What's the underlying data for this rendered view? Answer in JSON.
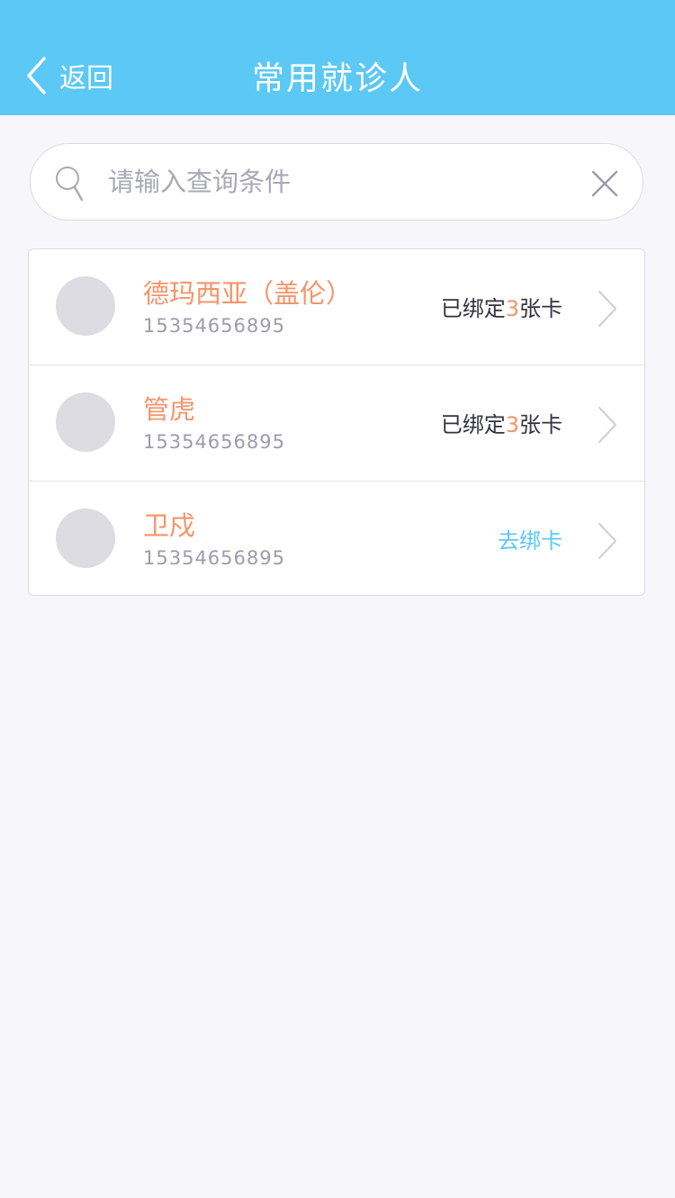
{
  "nav": {
    "back_label": "返回",
    "title": "常用就诊人"
  },
  "search": {
    "placeholder": "请输入查询条件",
    "value": ""
  },
  "patients": [
    {
      "name": "德玛西亚（盖伦）",
      "phone": "15354656895",
      "status_prefix": "已绑定",
      "card_count": "3",
      "status_suffix": "张卡"
    },
    {
      "name": "管虎",
      "phone": "15354656895",
      "status_prefix": "已绑定",
      "card_count": "3",
      "status_suffix": "张卡"
    },
    {
      "name": "卫戍",
      "phone": "15354656895",
      "bind_label": "去绑卡"
    }
  ],
  "colors": {
    "header": "#5bc8f5",
    "accent_orange": "#f6946a",
    "link_blue": "#5bc8f5",
    "background": "#f6f6fb"
  },
  "icons": {
    "back": "chevron-left-icon",
    "search": "search-icon",
    "clear": "close-icon",
    "row_arrow": "chevron-right-icon"
  }
}
